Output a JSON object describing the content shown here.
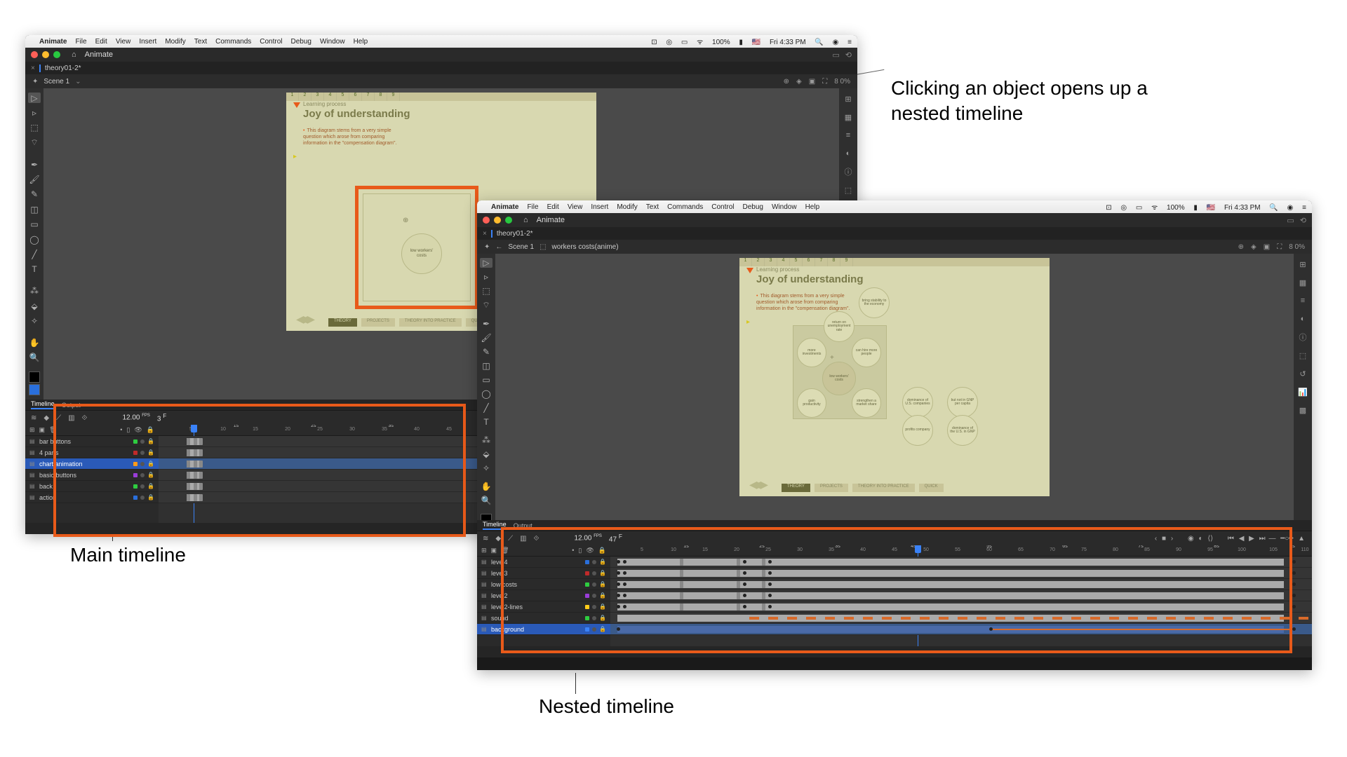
{
  "annotations": {
    "callout": "Clicking an object opens up a nested timeline",
    "main_tl": "Main timeline",
    "nested_tl": "Nested timeline"
  },
  "mac": {
    "apple": "",
    "menus": [
      "Animate",
      "File",
      "Edit",
      "View",
      "Insert",
      "Modify",
      "Text",
      "Commands",
      "Control",
      "Debug",
      "Window",
      "Help"
    ],
    "battery": "100%",
    "flag": "🇺🇸",
    "time": "Fri 4:33 PM"
  },
  "app": {
    "name": "Animate",
    "home_icon": "⌂",
    "doc_tab": "theory01-2*",
    "scene_a": "Scene 1",
    "scene_b_crumb": "Scene 1",
    "scene_b_symbol": "workers costs(anime)",
    "zoom_a": "8 0%",
    "zoom_b": "8 0%"
  },
  "stage": {
    "ruler": [
      "1",
      "2",
      "3",
      "4",
      "5",
      "6",
      "7",
      "8",
      "9"
    ],
    "subtitle": "Learning process",
    "title": "Joy of understanding",
    "body": "This diagram stems from a very simple question which arose from comparing information in the \"compensation diagram\".",
    "circle_a": "low workers' costs",
    "bottom_tabs": [
      "THEORY",
      "PROJECTS",
      "THEORY INTO PRACTICE",
      "QUICK"
    ],
    "nested_circles": {
      "main": "low workers' costs",
      "tl": "more investments",
      "tr": "can hire more people",
      "top": "return on unemployment rate",
      "topright": "bring stability to the economy",
      "bl": "gain productivity",
      "br": "strengthen a market share",
      "far_r1": "dominance of U.S. companies",
      "far_r2": "but not in GNP per capita",
      "bot1": "profits company",
      "bot2": "dominance of the U.S. in GNP"
    }
  },
  "timeline": {
    "tab": "Timeline",
    "tab2": "Output",
    "fps": "12.00",
    "fps_unit": "FPS",
    "frame_a": "3",
    "frame_b": "47",
    "frame_unit": "F"
  },
  "layers_a": [
    {
      "name": "bar buttons",
      "color": "#2ecc40"
    },
    {
      "name": "4 parts",
      "color": "#c02a2a"
    },
    {
      "name": "chart animation",
      "color": "#ff9a1a",
      "sel": true
    },
    {
      "name": "basic buttons",
      "color": "#9a3dd8"
    },
    {
      "name": "back",
      "color": "#2ecc40"
    },
    {
      "name": "action",
      "color": "#2a6fdb"
    }
  ],
  "layers_b": [
    {
      "name": "level4",
      "color": "#2a6fdb"
    },
    {
      "name": "level3",
      "color": "#c02a2a"
    },
    {
      "name": "low costs",
      "color": "#2ecc40"
    },
    {
      "name": "level2",
      "color": "#9a3dd8"
    },
    {
      "name": "level2-lines",
      "color": "#ffcc1a"
    },
    {
      "name": "sound",
      "color": "#2ecc40"
    },
    {
      "name": "background",
      "color": "#3a82f7",
      "sel": true
    }
  ],
  "ruler_a": [
    5,
    10,
    15,
    20,
    25,
    30,
    35,
    40,
    45
  ],
  "ruler_a_sec": [
    "1s",
    "2s",
    "3s"
  ],
  "ruler_b": [
    5,
    10,
    15,
    20,
    25,
    30,
    35,
    40,
    45,
    50,
    55,
    60,
    65,
    70,
    75,
    80,
    85,
    90,
    95,
    100,
    105,
    110
  ],
  "ruler_b_sec": [
    "1s",
    "2s",
    "3s",
    "4s",
    "5s",
    "6s",
    "7s",
    "8s",
    "9s"
  ]
}
